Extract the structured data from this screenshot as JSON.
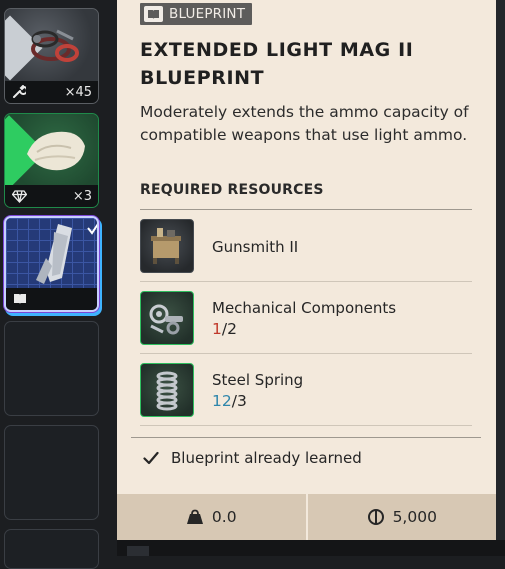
{
  "inventory": {
    "slots": [
      {
        "name": "cables-item",
        "badge_icon": "wrench-icon",
        "count": "×45"
      },
      {
        "name": "cloth-item",
        "badge_icon": "gem-icon",
        "count": "×3"
      },
      {
        "name": "blueprint-item",
        "badge_icon": "book-icon",
        "count": "",
        "selected": true,
        "learned_check": true
      }
    ]
  },
  "tooltip": {
    "category": "BLUEPRINT",
    "category_icon": "book-icon",
    "title": "EXTENDED LIGHT MAG II BLUEPRINT",
    "description": "Moderately extends the ammo capacity of compatible weapons that use light ammo.",
    "required_heading": "REQUIRED RESOURCES",
    "resources": [
      {
        "name": "Gunsmith II",
        "icon": "workbench-icon"
      },
      {
        "name": "Mechanical Components",
        "have": "1",
        "sep": "/",
        "need": "2",
        "have_color": "#c0392b"
      },
      {
        "name": "Steel Spring",
        "have": "12",
        "sep": "/",
        "need": "3",
        "have_color": "#2e86ab"
      }
    ],
    "status": "Blueprint already learned",
    "weight": "0.0",
    "value": "5,000"
  },
  "colors": {
    "panel_bg": "#f3e9dc",
    "bottom_bar_bg": "#d7c8b4",
    "tag_bg": "#5d5c5b",
    "rarity_green": "#2ecc61",
    "insufficient_red": "#c0392b",
    "sufficient_blue": "#2e86ab"
  }
}
